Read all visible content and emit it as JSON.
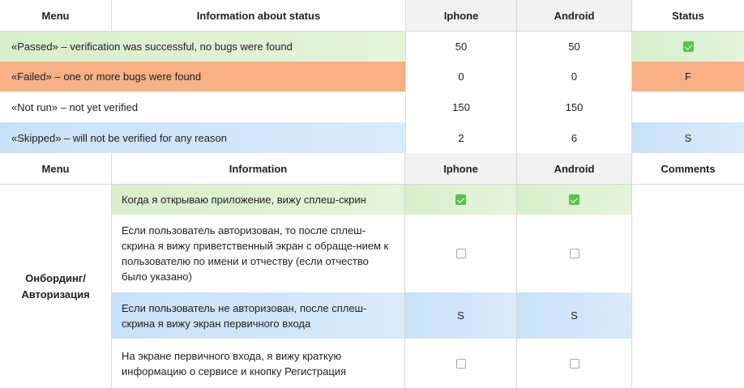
{
  "top_table": {
    "headers": [
      "Menu",
      "Information about status",
      "Iphone",
      "Android",
      "Status"
    ],
    "rows": [
      {
        "text": "«Passed» – verification was successful, no bugs were found",
        "iphone": "50",
        "android": "50",
        "status": "check",
        "color": "#d9f0cf"
      },
      {
        "text": "«Failed» – one or more bugs were found",
        "iphone": "0",
        "android": "0",
        "status": "F",
        "color": "#f8b184"
      },
      {
        "text": "«Not run» – not yet verified",
        "iphone": "150",
        "android": "150",
        "status": "",
        "color": "#ffffff"
      },
      {
        "text": "«Skipped» – will not be verified for any reason",
        "iphone": "2",
        "android": "6",
        "status": "S",
        "color": "#cfe4f9"
      }
    ]
  },
  "bottom_table": {
    "headers": [
      "Menu",
      "Information",
      "Iphone",
      "Android",
      "Comments"
    ],
    "menu_label": "Онбординг/ Авторизация",
    "rows": [
      {
        "text": "Когда я открываю приложение, вижу сплеш-скрин",
        "iphone": "checked",
        "android": "checked"
      },
      {
        "text": "Если пользователь авторизован, то после сплеш-скрина я вижу приветственный экран с обраще-нием к пользователю по имени и отчеству (если отчество было указано)",
        "iphone": "unchecked",
        "android": "unchecked"
      },
      {
        "text": "Если пользователь не авторизован, после сплеш-скрина я вижу экран первичного входа",
        "iphone": "S",
        "android": "S"
      },
      {
        "text": "На экране первичного входа, я вижу краткую информацию о сервисе и кнопку Регистрация",
        "iphone": "unchecked",
        "android": "unchecked"
      }
    ]
  }
}
